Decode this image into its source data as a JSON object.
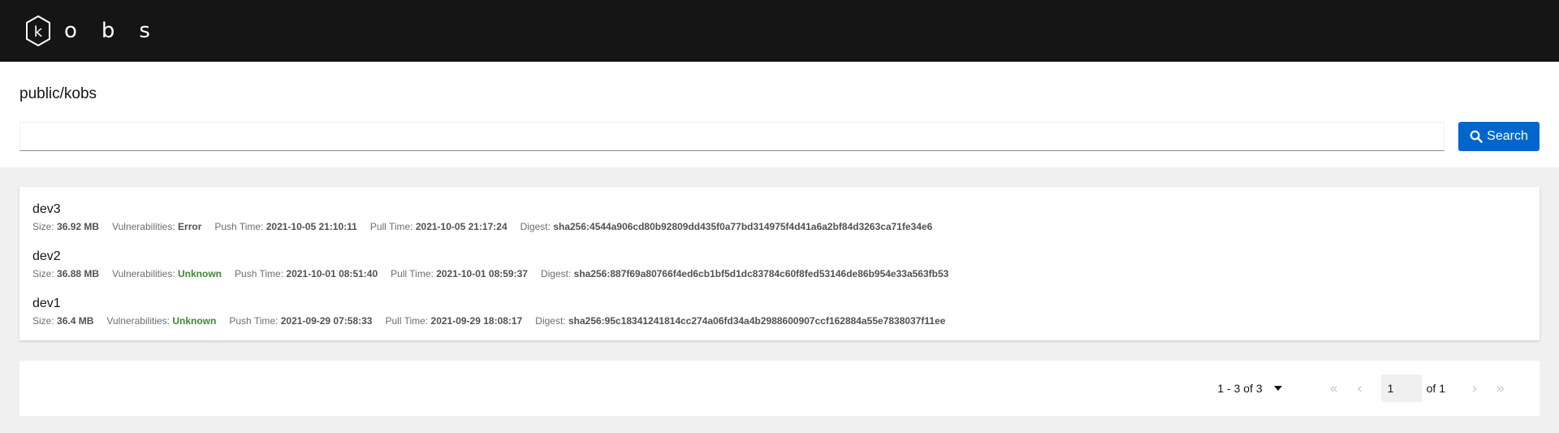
{
  "header": {
    "logo_letter": "k",
    "brand_rest": "obs"
  },
  "page": {
    "title": "public/kobs"
  },
  "search": {
    "value": "",
    "placeholder": "",
    "button_label": "Search"
  },
  "tags": [
    {
      "name": "dev3",
      "size_label": "Size:",
      "size": "36.92 MB",
      "vuln_label": "Vulnerabilities:",
      "vuln": "Error",
      "push_label": "Push Time:",
      "push": "2021-10-05 21:10:11",
      "pull_label": "Pull Time:",
      "pull": "2021-10-05 21:17:24",
      "digest_label": "Digest:",
      "digest": "sha256:4544a906cd80b92809dd435f0a77bd314975f4d41a6a2bf84d3263ca71fe34e6"
    },
    {
      "name": "dev2",
      "size_label": "Size:",
      "size": "36.88 MB",
      "vuln_label": "Vulnerabilities:",
      "vuln": "Unknown",
      "push_label": "Push Time:",
      "push": "2021-10-01 08:51:40",
      "pull_label": "Pull Time:",
      "pull": "2021-10-01 08:59:37",
      "digest_label": "Digest:",
      "digest": "sha256:887f69a80766f4ed6cb1bf5d1dc83784c60f8fed53146de86b954e33a563fb53"
    },
    {
      "name": "dev1",
      "size_label": "Size:",
      "size": "36.4 MB",
      "vuln_label": "Vulnerabilities:",
      "vuln": "Unknown",
      "push_label": "Push Time:",
      "push": "2021-09-29 07:58:33",
      "pull_label": "Pull Time:",
      "pull": "2021-09-29 18:08:17",
      "digest_label": "Digest:",
      "digest": "sha256:95c18341241814cc274a06fd34a4b2988600907ccf162884a55e7838037f11ee"
    }
  ],
  "pagination": {
    "range_label": "1 - 3 of 3",
    "current_page": "1",
    "of_pages": "of 1",
    "icons": [
      "first-page-icon",
      "previous-page-icon",
      "next-page-icon",
      "last-page-icon",
      "caret-down-icon",
      "search-icon",
      "kobs-logo-icon"
    ]
  },
  "colors": {
    "masthead": "#151515",
    "primary": "#0066cc",
    "vuln_unknown": "#3e8635",
    "background": "#f0f0f0"
  }
}
